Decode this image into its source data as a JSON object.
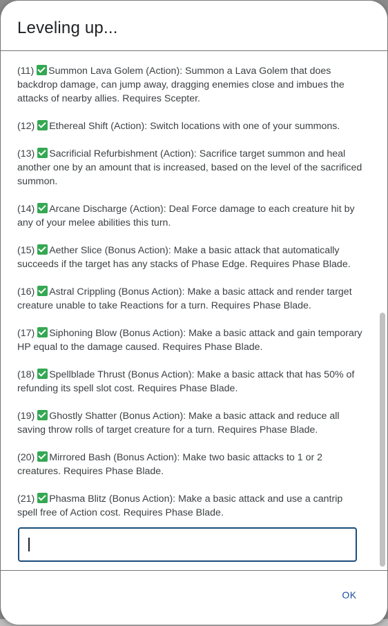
{
  "dialog": {
    "title": "Leveling up...",
    "ok_label": "OK"
  },
  "entries": [
    {
      "num": "(11)",
      "text": "Summon Lava Golem (Action): Summon a Lava Golem that does backdrop damage, can jump away, dragging enemies close and imbues the attacks of nearby allies. Requires Scepter."
    },
    {
      "num": "(12)",
      "text": "Ethereal Shift (Action): Switch locations with one of your summons."
    },
    {
      "num": "(13)",
      "text": "Sacrificial Refurbishment (Action): Sacrifice target summon and heal another one by an amount that is increased, based on the level of the sacrificed summon."
    },
    {
      "num": "(14)",
      "text": "Arcane Discharge (Action): Deal Force damage to each creature hit by any of your melee abilities this turn."
    },
    {
      "num": "(15)",
      "text": "Aether Slice (Bonus Action): Make a basic attack that automatically succeeds if the target has any stacks of Phase Edge. Requires Phase Blade."
    },
    {
      "num": "(16)",
      "text": "Astral Crippling (Bonus Action): Make a basic attack and render target creature unable to take Reactions for a turn. Requires Phase Blade."
    },
    {
      "num": "(17)",
      "text": "Siphoning Blow (Bonus Action): Make a basic attack and gain temporary HP equal to the damage caused. Requires Phase Blade."
    },
    {
      "num": "(18)",
      "text": "Spellblade Thrust (Bonus Action): Make a basic attack that has 50% of refunding its spell slot cost. Requires Phase Blade."
    },
    {
      "num": "(19)",
      "text": "Ghostly Shatter (Bonus Action): Make a basic attack and reduce all saving throw rolls of target creature for a turn. Requires Phase Blade."
    },
    {
      "num": "(20)",
      "text": "Mirrored Bash (Bonus Action): Make two basic attacks to 1 or 2 creatures. Requires Phase Blade."
    },
    {
      "num": "(21)",
      "text": "Phasma Blitz (Bonus Action): Make a basic attack and use a cantrip spell free of Action cost. Requires Phase Blade."
    }
  ],
  "input": {
    "value": "",
    "placeholder": ""
  },
  "icons": {
    "entry_marker": "check-mark-icon"
  },
  "colors": {
    "check_green": "#34a853",
    "ok_blue": "#1a4d9a",
    "input_border": "#1a4d7a"
  }
}
